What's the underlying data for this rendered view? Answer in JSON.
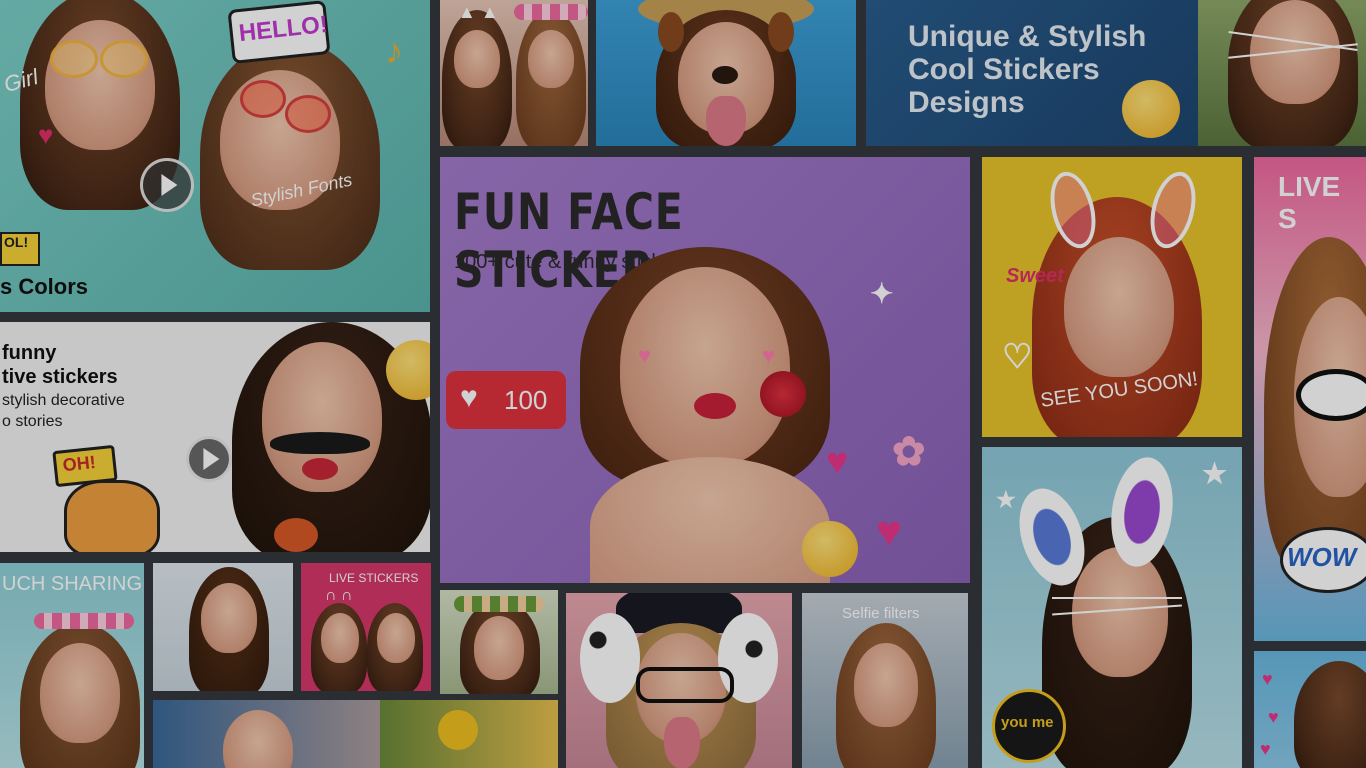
{
  "tiles": {
    "top_left": {
      "hello": "HELLO!",
      "girl": "Girl",
      "stylish_fonts": "Stylish Fonts",
      "colors": "s Colors",
      "cool": "OL!"
    },
    "top_right_banner": {
      "line1": "Unique & Stylish",
      "line2": "Cool Stickers",
      "line3": "Designs"
    },
    "center": {
      "title": "FUN FACE STICKER",
      "subtitle": "100+ cute & funny sticker camera",
      "likes": "100"
    },
    "yellow_tile": {
      "sweet": "Sweet",
      "see_you": "SEE YOU SOON!"
    },
    "right_edge": {
      "live": "LIVE S",
      "wow": "WOW"
    },
    "mid_left": {
      "line1": "funny",
      "line2": "tive stickers",
      "line3": "stylish decorative",
      "line4": "o stories",
      "oh": "OH!"
    },
    "bottom_left": {
      "sharing": "UCH SHARING"
    },
    "live_stickers": {
      "label": "LIVE STICKERS"
    },
    "selfie": {
      "label": "Selfie filters"
    },
    "bunny_tile": {
      "youme": "you me"
    }
  },
  "colors": {
    "background": "#2a2d31",
    "center_purple": "#9a6ec0",
    "banner_blue": "#1f4e78",
    "yellow": "#e8c52a",
    "teal": "#6fc5c0",
    "pink": "#d6386a"
  }
}
